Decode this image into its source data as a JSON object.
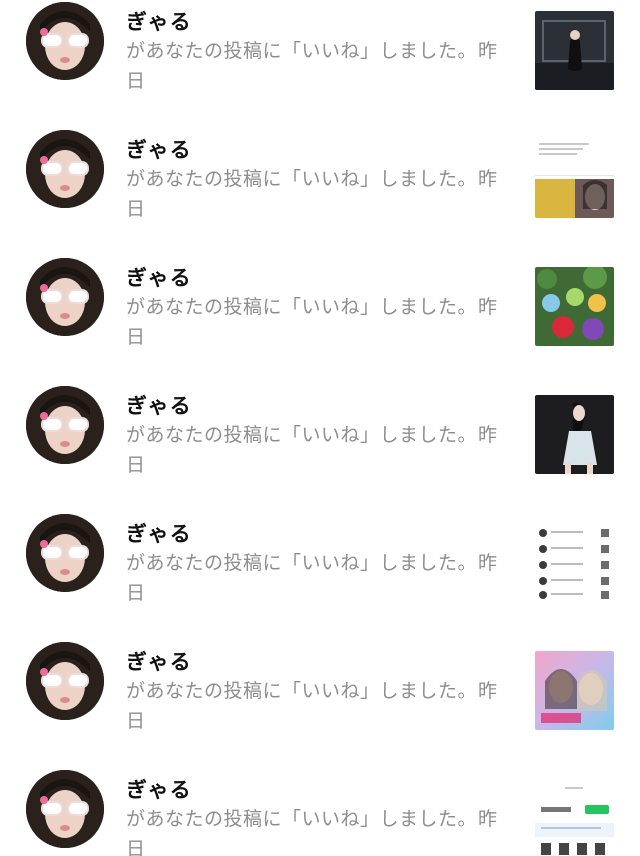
{
  "notifications": [
    {
      "username": "ぎゃる",
      "message": "があなたの投稿に「いいね」しました。",
      "time": "昨日",
      "thumbnail": "dark-room-dancer-photo"
    },
    {
      "username": "ぎゃる",
      "message": "があなたの投稿に「いいね」しました。",
      "time": "昨日",
      "thumbnail": "app-screenshot-portrait"
    },
    {
      "username": "ぎゃる",
      "message": "があなたの投稿に「いいね」しました。",
      "time": "昨日",
      "thumbnail": "plush-toys-photo"
    },
    {
      "username": "ぎゃる",
      "message": "があなたの投稿に「いいね」しました。",
      "time": "昨日",
      "thumbnail": "dancer-white-dress-photo"
    },
    {
      "username": "ぎゃる",
      "message": "があなたの投稿に「いいね」しました。",
      "time": "昨日",
      "thumbnail": "notification-list-screenshot"
    },
    {
      "username": "ぎゃる",
      "message": "があなたの投稿に「いいね」しました。",
      "time": "昨日",
      "thumbnail": "drama-poster"
    },
    {
      "username": "ぎゃる",
      "message": "があなたの投稿に「いいね」しました。",
      "time": "昨日",
      "thumbnail": "shopping-page-screenshot"
    }
  ]
}
